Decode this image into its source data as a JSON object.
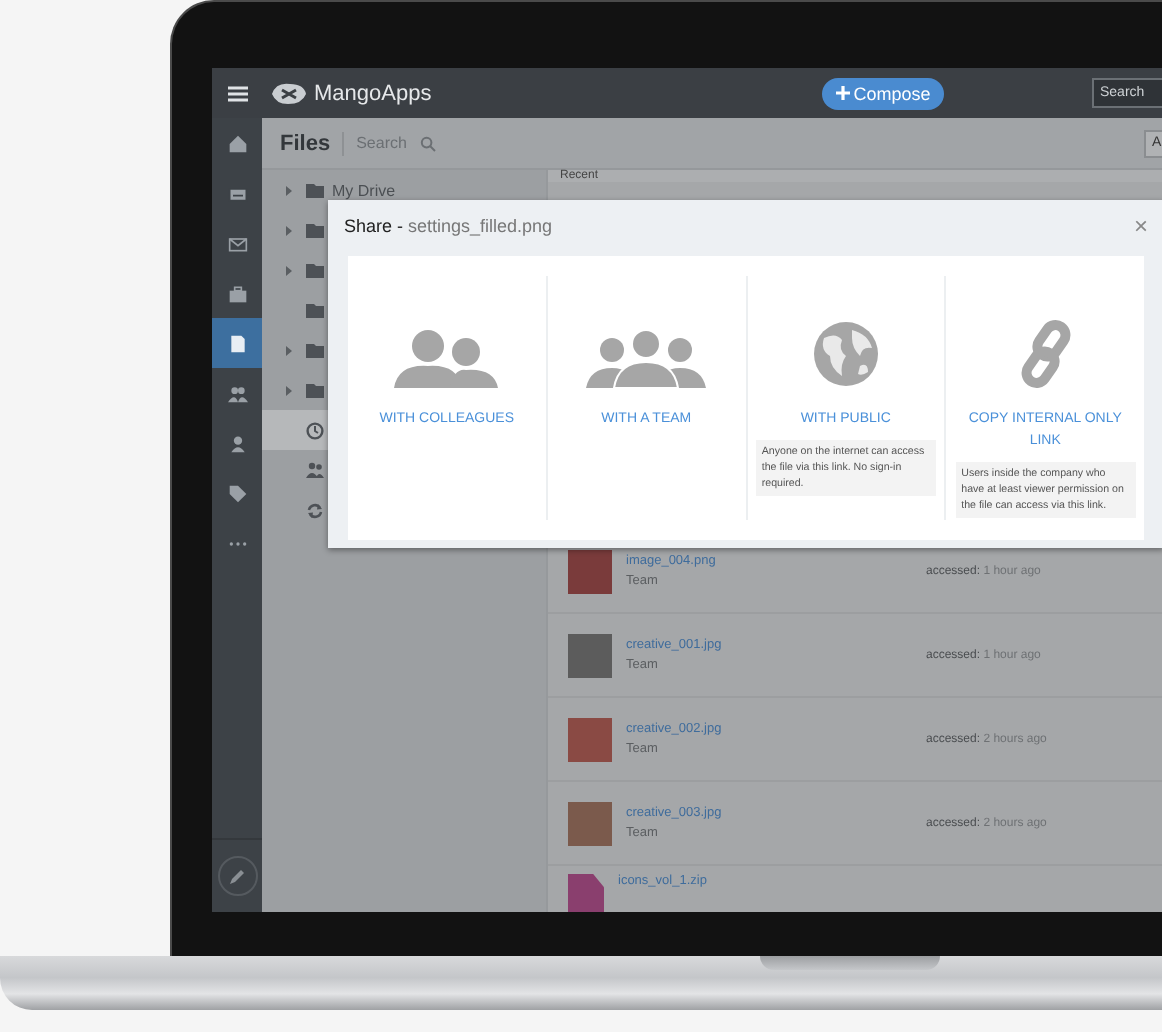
{
  "top_bar": {
    "app_name": "MangoApps",
    "compose_button": "Compose",
    "search": {
      "placeholder": "Search"
    }
  },
  "nav": [
    {
      "kind": "home",
      "selected": false
    },
    {
      "kind": "inbox",
      "selected": false
    },
    {
      "kind": "mail",
      "selected": false
    },
    {
      "kind": "briefcase",
      "selected": false
    },
    {
      "kind": "file",
      "selected": true
    },
    {
      "kind": "people",
      "selected": false
    },
    {
      "kind": "person",
      "selected": false
    },
    {
      "kind": "tag",
      "selected": false
    },
    {
      "kind": "more",
      "selected": false
    }
  ],
  "files_header": {
    "title": "Files",
    "search": {
      "placeholder": "Search"
    },
    "button": "A"
  },
  "tree": [
    {
      "kind": "folder",
      "label": "My Drive",
      "selected": false
    },
    {
      "kind": "folder",
      "selected": false
    },
    {
      "kind": "folder",
      "selected": false
    },
    {
      "kind": "folder-plain",
      "selected": false
    },
    {
      "kind": "folder",
      "selected": false
    },
    {
      "kind": "folder",
      "selected": false
    },
    {
      "kind": "recent",
      "selected": true
    },
    {
      "kind": "team",
      "selected": false
    },
    {
      "kind": "sync",
      "selected": false
    }
  ],
  "files": {
    "header": "Recent",
    "rows": [
      {
        "kind": "image",
        "name": "image_004.png",
        "owner": "Team",
        "accessed_label": "accessed:",
        "accessed": "1 hour ago",
        "color": "#7a3b3b"
      },
      {
        "kind": "image",
        "name": "creative_001.jpg",
        "owner": "Team",
        "accessed_label": "accessed:",
        "accessed": "1 hour ago",
        "color": "#5c5c5c"
      },
      {
        "kind": "image",
        "name": "creative_002.jpg",
        "owner": "Team",
        "accessed_label": "accessed:",
        "accessed": "2 hours ago",
        "color": "#8a4a44"
      },
      {
        "kind": "image",
        "name": "creative_003.jpg",
        "owner": "Team",
        "accessed_label": "accessed:",
        "accessed": "2 hours ago",
        "color": "#7b5a4c"
      },
      {
        "kind": "archive",
        "name": "icons_vol_1.zip",
        "color": "#8a3f6e"
      }
    ]
  },
  "share_dialog": {
    "title": "**Share -** settings_filled.png",
    "close": "×",
    "options": [
      {
        "kind": "colleagues",
        "label": "WITH COLLEAGUES"
      },
      {
        "kind": "team",
        "label": "WITH A TEAM"
      },
      {
        "kind": "public",
        "label": "WITH PUBLIC",
        "note": "Anyone on the internet can access the file via this link. No sign-in required."
      },
      {
        "kind": "link",
        "label": "COPY INTERNAL ONLY LINK",
        "note": "Users inside the company who have at least viewer permission on the file can access via this link."
      }
    ]
  }
}
